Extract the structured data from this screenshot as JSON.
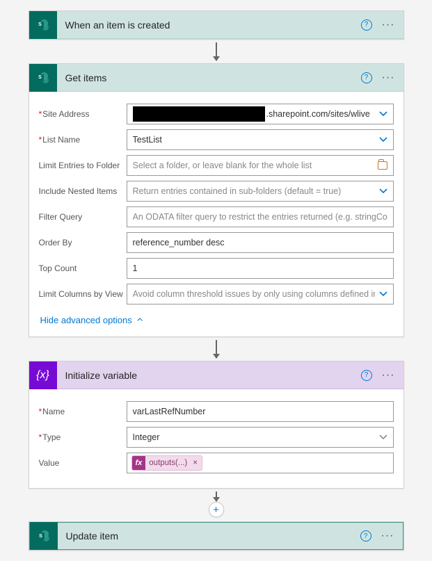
{
  "trigger": {
    "title": "When an item is created"
  },
  "getItems": {
    "title": "Get items",
    "fields": {
      "siteAddress": {
        "label": "Site Address",
        "suffix": ".sharepoint.com/sites/wlive"
      },
      "listName": {
        "label": "List Name",
        "value": "TestList"
      },
      "limitFolder": {
        "label": "Limit Entries to Folder",
        "placeholder": "Select a folder, or leave blank for the whole list"
      },
      "nested": {
        "label": "Include Nested Items",
        "placeholder": "Return entries contained in sub-folders (default = true)"
      },
      "filter": {
        "label": "Filter Query",
        "placeholder": "An ODATA filter query to restrict the entries returned (e.g. stringColumn eq 'stri"
      },
      "orderBy": {
        "label": "Order By",
        "value": "reference_number desc"
      },
      "topCount": {
        "label": "Top Count",
        "value": "1"
      },
      "limitCols": {
        "label": "Limit Columns by View",
        "placeholder": "Avoid column threshold issues by only using columns defined in a view"
      }
    },
    "advToggle": "Hide advanced options"
  },
  "initVar": {
    "title": "Initialize variable",
    "fields": {
      "name": {
        "label": "Name",
        "value": "varLastRefNumber"
      },
      "type": {
        "label": "Type",
        "value": "Integer"
      },
      "value": {
        "label": "Value",
        "expression": "outputs(...)"
      }
    }
  },
  "updateItem": {
    "title": "Update item"
  },
  "icons": {
    "fx": "fx",
    "plus": "+",
    "ellipsis": "···",
    "help": "?",
    "s": "S"
  }
}
